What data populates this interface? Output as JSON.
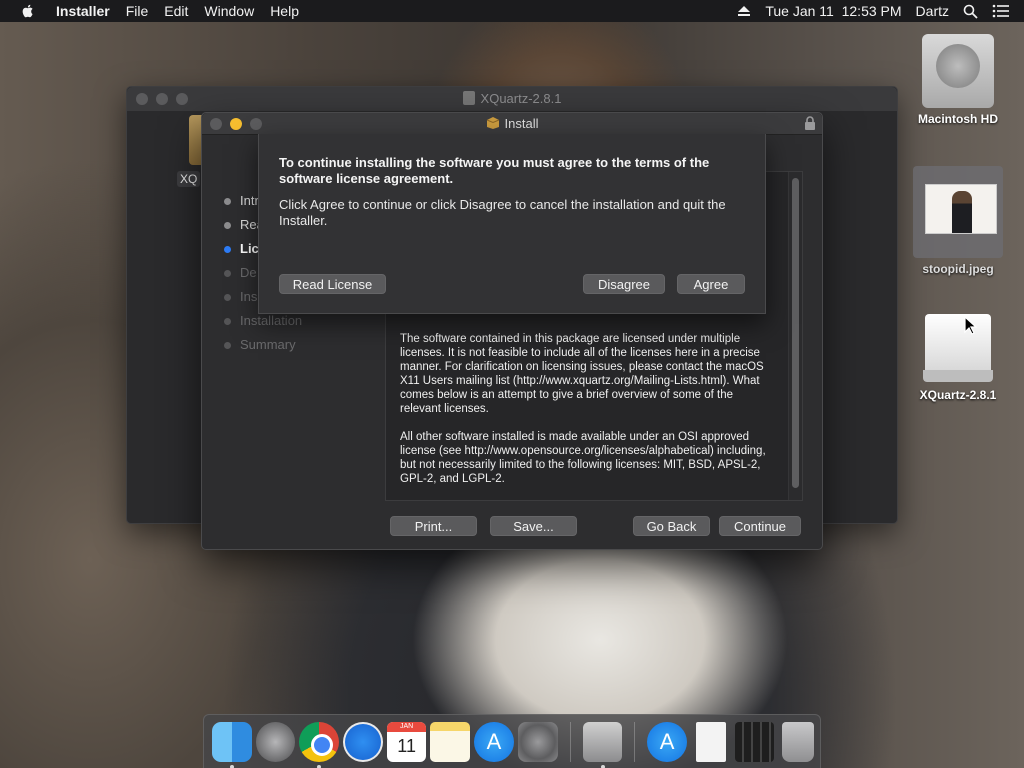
{
  "menubar": {
    "app_name": "Installer",
    "menus": [
      "File",
      "Edit",
      "Window",
      "Help"
    ],
    "datetime": "Tue Jan 11  12:53 PM",
    "user": "Dartz"
  },
  "back_window": {
    "title": "XQuartz-2.8.1",
    "volume_label": "XQ"
  },
  "installer": {
    "title": "Install",
    "steps": [
      {
        "label": "Intr",
        "state": "done"
      },
      {
        "label": "Rea",
        "state": "done"
      },
      {
        "label": "Lic",
        "state": "active"
      },
      {
        "label": "De",
        "state": "future"
      },
      {
        "label": "Ins",
        "state": "future"
      },
      {
        "label": "Installation",
        "state": "future"
      },
      {
        "label": "Summary",
        "state": "future"
      }
    ],
    "license_paragraphs": [
      "The software contained in this package are licensed under multiple licenses.  It is not feasible to include all of the licenses here in a precise manner.  For clarification on licensing issues, please contact the macOS X11 Users mailing list (http://www.xquartz.org/Mailing-Lists.html).  What comes below is an attempt to give a brief overview of some of the relevant licenses.",
      "All other software installed is made available under an OSI approved license (see http://www.opensource.org/licenses/alphabetical) including, but not necessarily limited to the following licenses: MIT, BSD, APSL-2, GPL-2, and LGPL-2."
    ],
    "buttons": {
      "print": "Print...",
      "save": "Save...",
      "go_back": "Go Back",
      "continue": "Continue"
    }
  },
  "sheet": {
    "title": "To continue installing the software you must agree to the terms of the software license agreement.",
    "body": "Click Agree to continue or click Disagree to cancel the installation and quit the Installer.",
    "buttons": {
      "read_license": "Read License",
      "disagree": "Disagree",
      "agree": "Agree"
    }
  },
  "desktop": {
    "icons": [
      {
        "label": "Macintosh HD"
      },
      {
        "label": "stoopid.jpeg"
      },
      {
        "label": "XQuartz-2.8.1"
      }
    ]
  },
  "dock": {
    "calendar": {
      "month": "JAN",
      "day": "11"
    },
    "apps": [
      "finder",
      "launchpad",
      "chrome",
      "safari",
      "calendar",
      "notes",
      "app-store",
      "system-preferences",
      "installer",
      "app-store",
      "document",
      "grid-app",
      "trash"
    ]
  },
  "colors": {
    "accent": "#2d7cf6",
    "minimize": "#f5bd2f",
    "window": "#2d2d2f",
    "menubar": "#1b1b1d"
  }
}
